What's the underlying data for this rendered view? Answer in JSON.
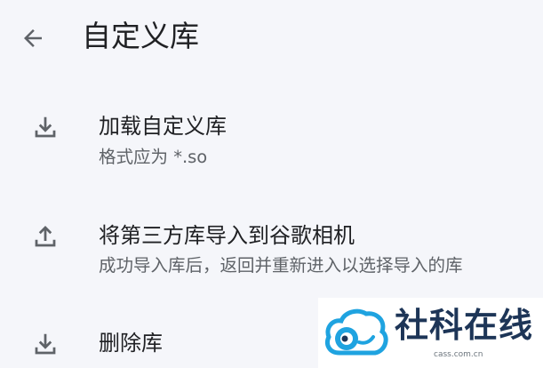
{
  "header": {
    "title": "自定义库",
    "back_icon": "arrow-left-icon"
  },
  "items": [
    {
      "icon": "download-icon",
      "primary": "加载自定义库",
      "secondary": "格式应为 *.so"
    },
    {
      "icon": "upload-icon",
      "primary": "将第三方库导入到谷歌相机",
      "secondary": "成功导入库后，返回并重新进入以选择导入的库"
    },
    {
      "icon": "download-icon",
      "primary": "删除库"
    }
  ],
  "watermark": {
    "text": "社科在线",
    "url": "cass.com.cn",
    "logo_icon": "cloud-logo-icon"
  },
  "colors": {
    "background": "#f5f6fa",
    "icon": "#5f6368",
    "primary_text": "#202124",
    "secondary_text": "#5f6368",
    "watermark_blue": "#1fa3e0",
    "watermark_text": "#1d3557"
  }
}
